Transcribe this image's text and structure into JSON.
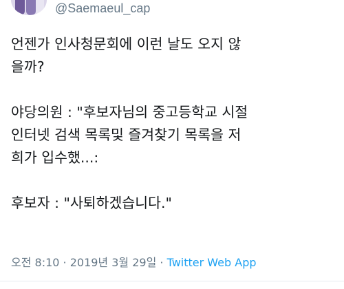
{
  "tweet": {
    "handle": "@Saemaeul_cap",
    "lines": [
      "언젠가 인사청문회에 이런 날도 오지 않",
      "을까?",
      "",
      "야당의원 : \"후보자님의 중고등학교 시절",
      "인터넷 검색 목록및 즐겨찾기 목록을 저",
      "희가 입수했...:",
      "",
      "후보자 : \"사퇴하겠습니다.\""
    ],
    "timestamp": "오전 8:10 · 2019년 3월 29일 · ",
    "source": "Twitter Web App"
  },
  "colors": {
    "text": "#14171a",
    "secondary": "#657786",
    "link": "#1da1f2"
  }
}
